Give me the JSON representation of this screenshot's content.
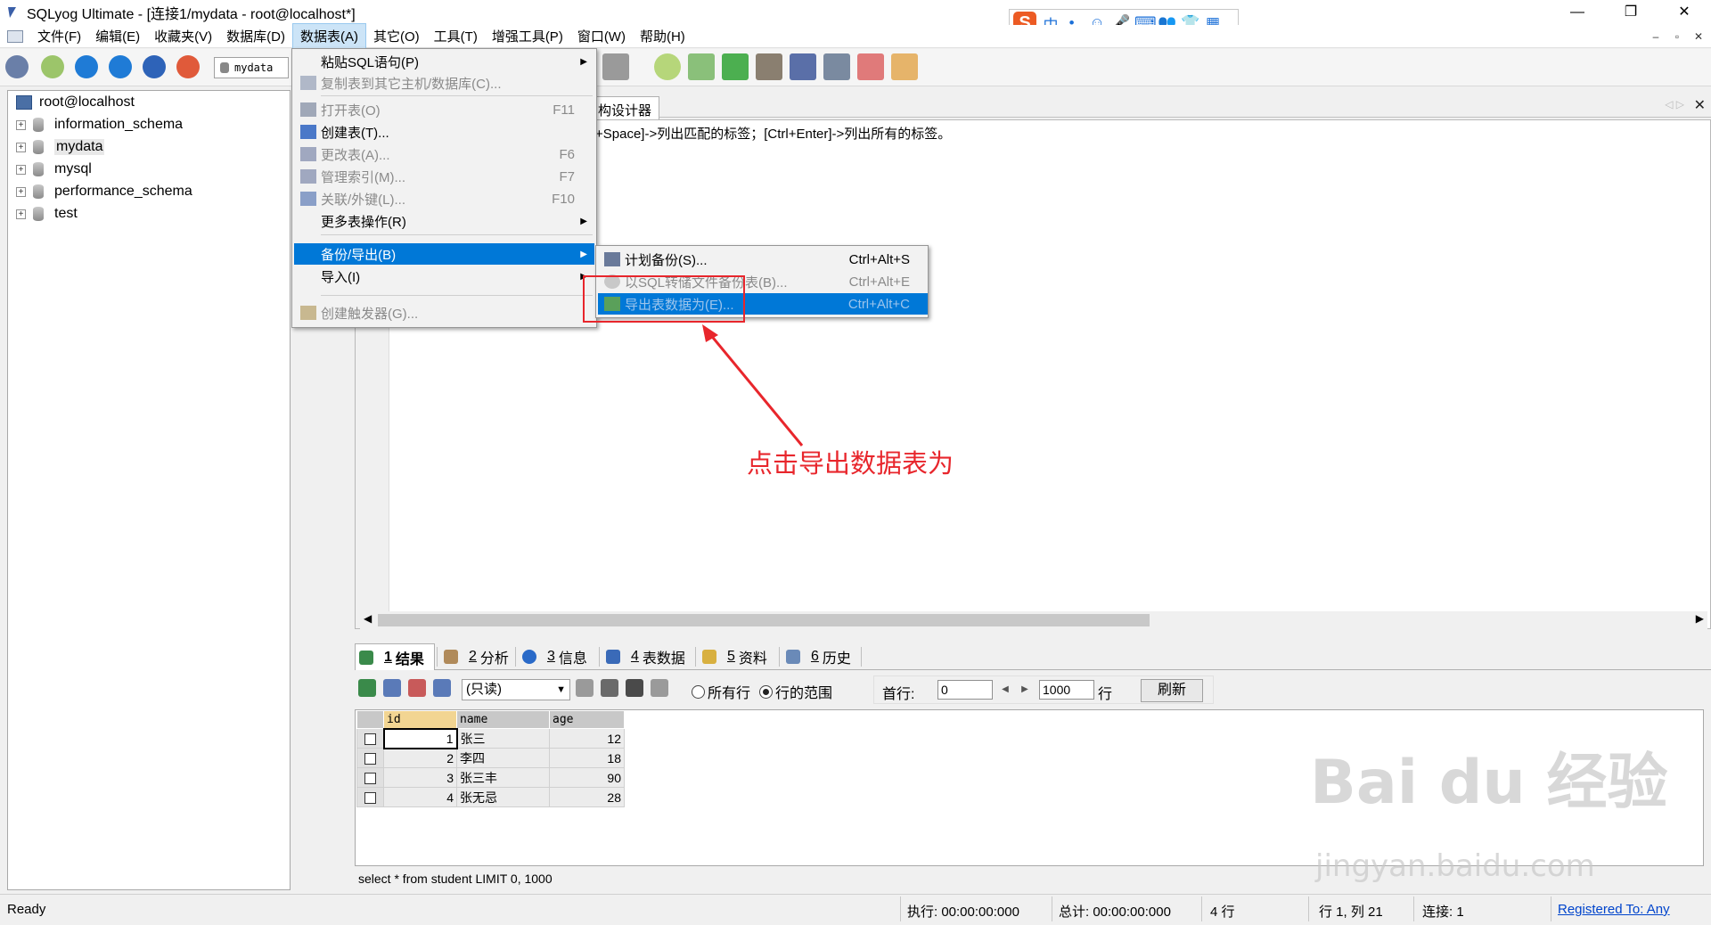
{
  "window": {
    "title": "SQLyog Ultimate - [连接1/mydata - root@localhost*]",
    "controls": [
      "—",
      "❐",
      "✕"
    ]
  },
  "menubar": {
    "items": [
      "文件(F)",
      "编辑(E)",
      "收藏夹(V)",
      "数据库(D)",
      "数据表(A)",
      "其它(O)",
      "工具(T)",
      "增强工具(P)",
      "窗口(W)",
      "帮助(H)"
    ],
    "active_index": 4,
    "mdi_controls": [
      "–",
      "▫",
      "✕"
    ]
  },
  "ime": {
    "logo": "S",
    "items": [
      "中",
      "•,",
      "☺",
      "🎤",
      "⌨",
      "👥",
      "👕",
      "▦"
    ]
  },
  "toolbar": {
    "database_selector": "mydata"
  },
  "object_browser": {
    "root": "root@localhost",
    "databases": [
      "information_schema",
      "mydata",
      "mysql",
      "performance_schema",
      "test"
    ],
    "selected": "mydata"
  },
  "editor": {
    "tab_label": "构设计器",
    "hint": "+Space]->列出匹配的标签；[Ctrl+Enter]->列出所有的标签。"
  },
  "table_menu": {
    "items": [
      {
        "label": "粘贴SQL语句(P)",
        "shortcut": "",
        "submenu": true,
        "disabled": false,
        "icon": ""
      },
      {
        "label": "复制表到其它主机/数据库(C)...",
        "shortcut": "",
        "submenu": false,
        "disabled": true,
        "icon": "copy-table-icon"
      },
      {
        "label": "打开表(O)",
        "shortcut": "F11",
        "submenu": false,
        "disabled": true,
        "icon": "open-table-icon"
      },
      {
        "label": "创建表(T)...",
        "shortcut": "",
        "submenu": false,
        "disabled": false,
        "icon": "create-table-icon"
      },
      {
        "label": "更改表(A)...",
        "shortcut": "F6",
        "submenu": false,
        "disabled": true,
        "icon": "alter-table-icon"
      },
      {
        "label": "管理索引(M)...",
        "shortcut": "F7",
        "submenu": false,
        "disabled": true,
        "icon": "index-icon"
      },
      {
        "label": "关联/外键(L)...",
        "shortcut": "F10",
        "submenu": false,
        "disabled": true,
        "icon": "foreign-key-icon"
      },
      {
        "label": "更多表操作(R)",
        "shortcut": "",
        "submenu": true,
        "disabled": false,
        "icon": ""
      },
      {
        "label": "备份/导出(B)",
        "shortcut": "",
        "submenu": true,
        "disabled": false,
        "icon": "",
        "highlight": true
      },
      {
        "label": "导入(I)",
        "shortcut": "",
        "submenu": true,
        "disabled": false,
        "icon": ""
      },
      {
        "label": "创建触发器(G)...",
        "shortcut": "",
        "submenu": false,
        "disabled": true,
        "icon": "trigger-icon"
      }
    ]
  },
  "backup_submenu": {
    "items": [
      {
        "label": "计划备份(S)...",
        "shortcut": "Ctrl+Alt+S",
        "disabled": false
      },
      {
        "label": "以SQL转储文件备份表(B)...",
        "shortcut": "Ctrl+Alt+E",
        "disabled": true
      },
      {
        "label": "导出表数据为(E)...",
        "shortcut": "Ctrl+Alt+C",
        "disabled": true,
        "highlight": true
      }
    ]
  },
  "annotation": {
    "text": "点击导出数据表为",
    "color": "#e8262c"
  },
  "result_tabs": {
    "tabs": [
      {
        "num": "1",
        "label": "结果",
        "active": true
      },
      {
        "num": "2",
        "label": "分析",
        "active": false
      },
      {
        "num": "3",
        "label": "信息",
        "active": false
      },
      {
        "num": "4",
        "label": "表数据",
        "active": false
      },
      {
        "num": "5",
        "label": "资料",
        "active": false
      },
      {
        "num": "6",
        "label": "历史",
        "active": false
      }
    ]
  },
  "result_toolbar": {
    "mode": "(只读)",
    "radio_all": "所有行",
    "radio_range": "行的范围",
    "range_selected": true,
    "first_row_label": "首行:",
    "first_row": "0",
    "count": "1000",
    "rows_label": "行",
    "refresh": "刷新"
  },
  "grid": {
    "columns": [
      "id",
      "name",
      "age"
    ],
    "rows": [
      [
        "1",
        "张三",
        "12"
      ],
      [
        "2",
        "李四",
        "18"
      ],
      [
        "3",
        "张三丰",
        "90"
      ],
      [
        "4",
        "张无忌",
        "28"
      ]
    ]
  },
  "query_text": "select * from student  LIMIT 0, 1000",
  "statusbar": {
    "status": "Ready",
    "exec_time": "执行: 00:00:00:000",
    "total_time": "总计: 00:00:00:000",
    "rows": "4 行",
    "position": "行 1, 列 21",
    "connections": "连接: 1",
    "registered": "Registered To: Any"
  },
  "watermark": {
    "line1": "Bai du 经验",
    "line2": "jingyan.baidu.com"
  }
}
